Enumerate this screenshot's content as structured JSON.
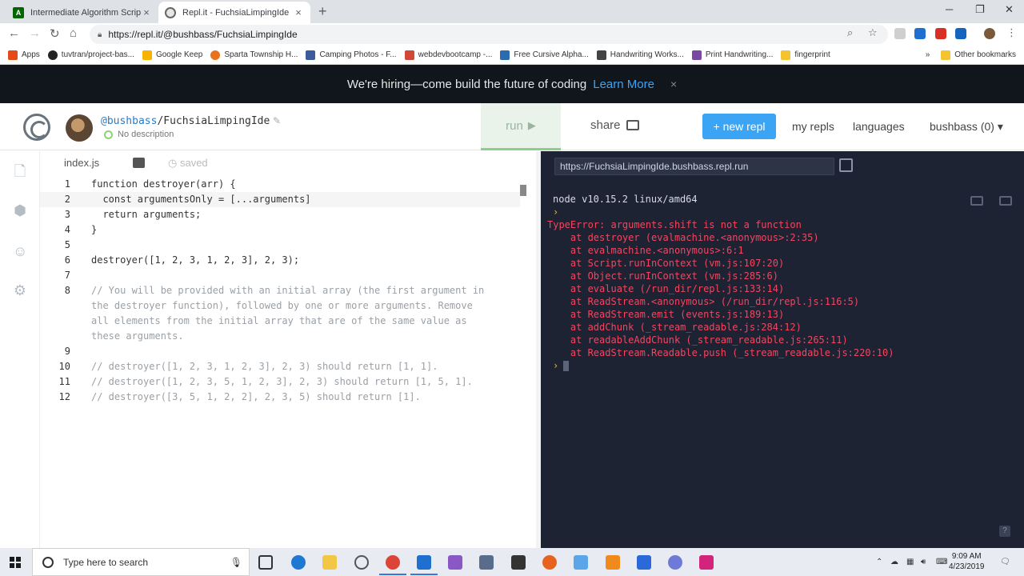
{
  "browser": {
    "tabs": [
      {
        "title": "Intermediate Algorithm Scripting",
        "active": false,
        "icon": "freecodecamp-icon"
      },
      {
        "title": "Repl.it - FuchsiaLimpingIde",
        "active": true,
        "icon": "replit-icon"
      }
    ],
    "url": "https://repl.it/@bushbass/FuchsiaLimpingIde",
    "bookmarks": [
      {
        "label": "Apps",
        "icon": "apps-grid-icon",
        "color": "#e64a19"
      },
      {
        "label": "tuvtran/project-bas...",
        "icon": "github-icon",
        "color": "#222222"
      },
      {
        "label": "Google Keep",
        "icon": "keep-icon",
        "color": "#f6b400"
      },
      {
        "label": "Sparta Township H...",
        "icon": "sparta-icon",
        "color": "#e8731d"
      },
      {
        "label": "Camping Photos - F...",
        "icon": "flickr-icon",
        "color": "#3b5b9c"
      },
      {
        "label": "webdevbootcamp -...",
        "icon": "udemy-icon",
        "color": "#d14836"
      },
      {
        "label": "Free Cursive Alpha...",
        "icon": "cursive-icon",
        "color": "#2b6cb0"
      },
      {
        "label": "Handwriting Works...",
        "icon": "pencil-icon",
        "color": "#444444"
      },
      {
        "label": "Print Handwriting...",
        "icon": "print-icon",
        "color": "#7a4aa3"
      },
      {
        "label": "fingerprint",
        "icon": "folder-icon",
        "color": "#f4c430"
      }
    ],
    "more_bookmarks": "»",
    "other_bookmarks": "Other bookmarks"
  },
  "banner": {
    "text": "We're hiring—come build the future of coding",
    "link": "Learn More",
    "close": "×"
  },
  "repl": {
    "user": "@bushbass",
    "slash": "/",
    "name": "FuchsiaLimpingIde",
    "description": "No description",
    "run_label": "run",
    "share_label": "share",
    "new_repl_label": "+ new repl",
    "my_repls_label": "my repls",
    "languages_label": "languages",
    "account_label": "bushbass (0)"
  },
  "editor": {
    "file_tab": "index.js",
    "save_status": "saved",
    "lines": [
      {
        "n": "1",
        "text": "function destroyer(arr) {"
      },
      {
        "n": "2",
        "text": "  const argumentsOnly = [...arguments]"
      },
      {
        "n": "3",
        "text": "  return arguments;"
      },
      {
        "n": "4",
        "text": "}"
      },
      {
        "n": "5",
        "text": ""
      },
      {
        "n": "6",
        "text": "destroyer([1, 2, 3, 1, 2, 3], 2, 3);"
      },
      {
        "n": "7",
        "text": ""
      },
      {
        "n": "8",
        "text": "// You will be provided with an initial array (the first argument in"
      },
      {
        "n": "",
        "text": "the destroyer function), followed by one or more arguments. Remove"
      },
      {
        "n": "",
        "text": "all elements from the initial array that are of the same value as"
      },
      {
        "n": "",
        "text": "these arguments."
      },
      {
        "n": "9",
        "text": ""
      },
      {
        "n": "10",
        "text": "// destroyer([1, 2, 3, 1, 2, 3], 2, 3) should return [1, 1]."
      },
      {
        "n": "11",
        "text": "// destroyer([1, 2, 3, 5, 1, 2, 3], 2, 3) should return [1, 5, 1]."
      },
      {
        "n": "12",
        "text": "// destroyer([3, 5, 1, 2, 2], 2, 3, 5) should return [1]."
      }
    ]
  },
  "console": {
    "url": "https://FuchsiaLimpingIde.bushbass.repl.run",
    "header": "node v10.15.2 linux/amd64",
    "prompt": "›",
    "error_lines": [
      "TypeError: arguments.shift is not a function",
      "    at destroyer (evalmachine.<anonymous>:2:35)",
      "    at evalmachine.<anonymous>:6:1",
      "    at Script.runInContext (vm.js:107:20)",
      "    at Object.runInContext (vm.js:285:6)",
      "    at evaluate (/run_dir/repl.js:133:14)",
      "    at ReadStream.<anonymous> (/run_dir/repl.js:116:5)",
      "    at ReadStream.emit (events.js:189:13)",
      "    at addChunk (_stream_readable.js:284:12)",
      "    at readableAddChunk (_stream_readable.js:265:11)",
      "    at ReadStream.Readable.push (_stream_readable.js:220:10)"
    ],
    "help": "?"
  },
  "taskbar": {
    "search_placeholder": "Type here to search",
    "time": "9:09 AM",
    "date": "4/23/2019"
  },
  "colors": {
    "banner_bg": "#11151c",
    "accent_blue": "#3ba4f5",
    "console_bg": "#1d2333",
    "error_red": "#f04760",
    "run_green": "#8ccf8a"
  }
}
